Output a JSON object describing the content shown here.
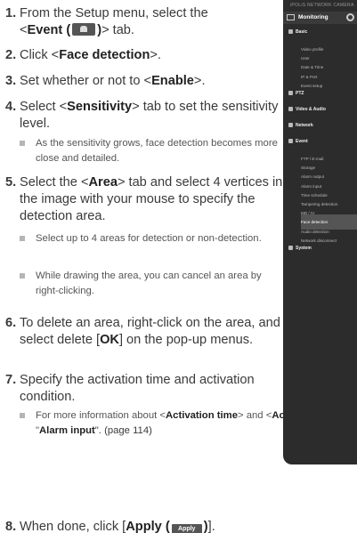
{
  "steps": [
    {
      "num": "1.",
      "pre": "From the Setup menu, select the",
      "tag_open": "<",
      "bold": "Event (",
      "bold_close": ")",
      "tag_close": "> tab."
    },
    {
      "num": "2.",
      "pre": "Click <",
      "bold": "Face detection",
      "post": ">."
    },
    {
      "num": "3.",
      "pre": "Set whether or not to <",
      "bold": "Enable",
      "post": ">."
    },
    {
      "num": "4.",
      "pre": "Select <",
      "bold": "Sensitivity",
      "post": "> tab to set the sensitivity level."
    },
    {
      "num": "5.",
      "pre": "Select the <",
      "bold": "Area",
      "post": "> tab and select 4 vertices in the image with your mouse to specify the detection area."
    },
    {
      "num": "6.",
      "pre": "To delete an area, right-click on the area, and select delete [",
      "bold": "OK",
      "post": "] on the pop-up menus."
    },
    {
      "num": "7.",
      "pre": "Specify the activation time and activation condition."
    },
    {
      "num": "8.",
      "pre": "When done, click [",
      "bold": "Apply (",
      "bold_close": ")",
      "post": "]."
    }
  ],
  "notes": {
    "step4": "As the sensitivity grows, face detection becomes more close and detailed.",
    "step5a": "Select up to 4 areas for detection or non-detection.",
    "step5b": "While drawing the area, you can cancel an area by right-clicking.",
    "step7_pre": "For more information about <",
    "step7_b1": "Activation time",
    "step7_mid": "> and <",
    "step7_b2": "Action",
    "step7_post": ">, refer to \"",
    "step7_b3": "Alarm input",
    "step7_end": "\". (page 114)"
  },
  "apply_button_label": "Apply",
  "panel": {
    "title": "iPOLiS NETWORK CAMERA",
    "monitoring": "Monitoring",
    "categories": [
      {
        "label": "Basic",
        "items": [
          "Video profile",
          "User",
          "Date & Time",
          "IP & Port",
          "Event setup"
        ]
      },
      {
        "label": "PTZ",
        "items": []
      },
      {
        "label": "Video & Audio",
        "items": []
      },
      {
        "label": "Network",
        "items": []
      },
      {
        "label": "Event",
        "items": [
          "FTP / E-mail",
          "Storage",
          "Alarm output",
          "Alarm input",
          "Time schedule",
          "Tampering detection",
          "MD / IV",
          "Face detection",
          "Audio detection",
          "Network disconnect"
        ]
      },
      {
        "label": "System",
        "items": []
      }
    ],
    "active_item": "Face detection"
  }
}
